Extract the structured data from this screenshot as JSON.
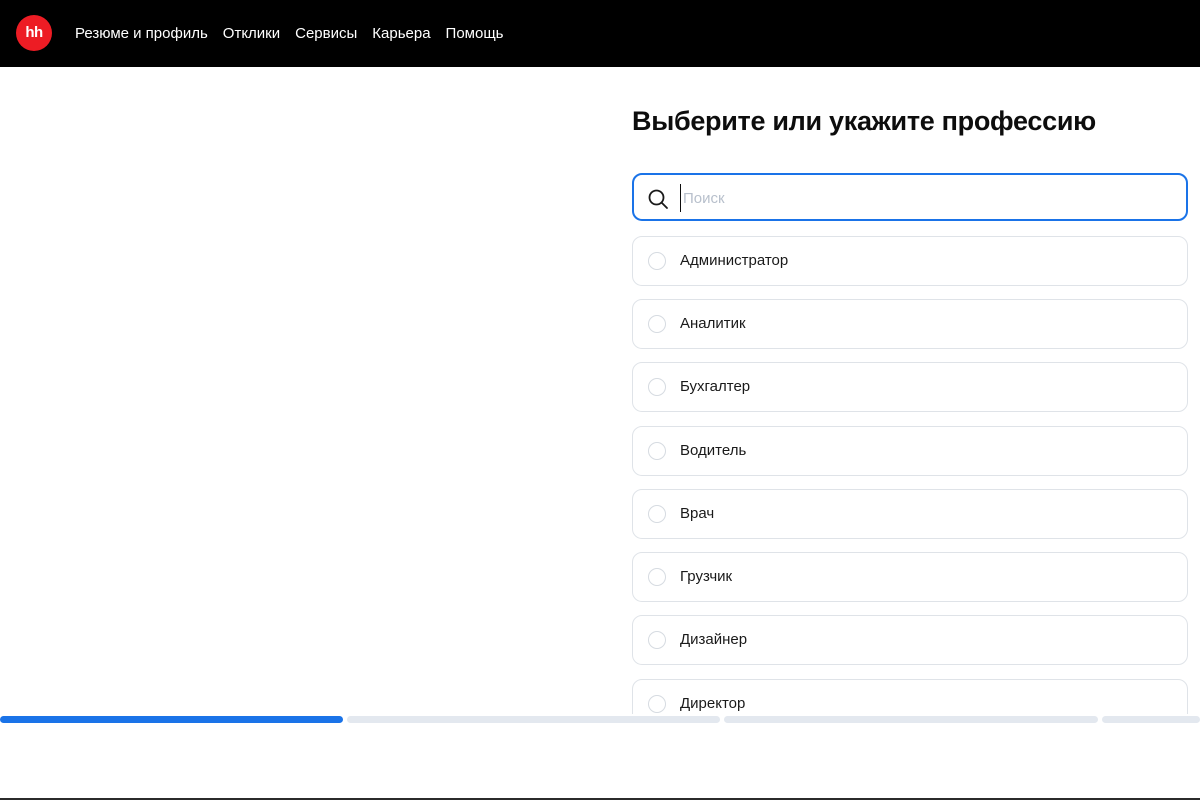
{
  "header": {
    "logo_text": "hh",
    "brand_color": "#ed1c24",
    "nav": [
      {
        "label": "Резюме и профиль"
      },
      {
        "label": "Отклики"
      },
      {
        "label": "Сервисы"
      },
      {
        "label": "Карьера"
      },
      {
        "label": "Помощь"
      }
    ]
  },
  "main": {
    "title": "Выберите или укажите профессию",
    "search": {
      "placeholder": "Поиск",
      "value": "",
      "icon": "search-icon"
    },
    "professions": [
      {
        "label": "Администратор",
        "selected": false
      },
      {
        "label": "Аналитик",
        "selected": false
      },
      {
        "label": "Бухгалтер",
        "selected": false
      },
      {
        "label": "Водитель",
        "selected": false
      },
      {
        "label": "Врач",
        "selected": false
      },
      {
        "label": "Грузчик",
        "selected": false
      },
      {
        "label": "Дизайнер",
        "selected": false
      },
      {
        "label": "Директор",
        "selected": false
      }
    ]
  },
  "progress": {
    "steps_total": 4,
    "current_step": 1,
    "accent_color": "#1a73e8"
  }
}
